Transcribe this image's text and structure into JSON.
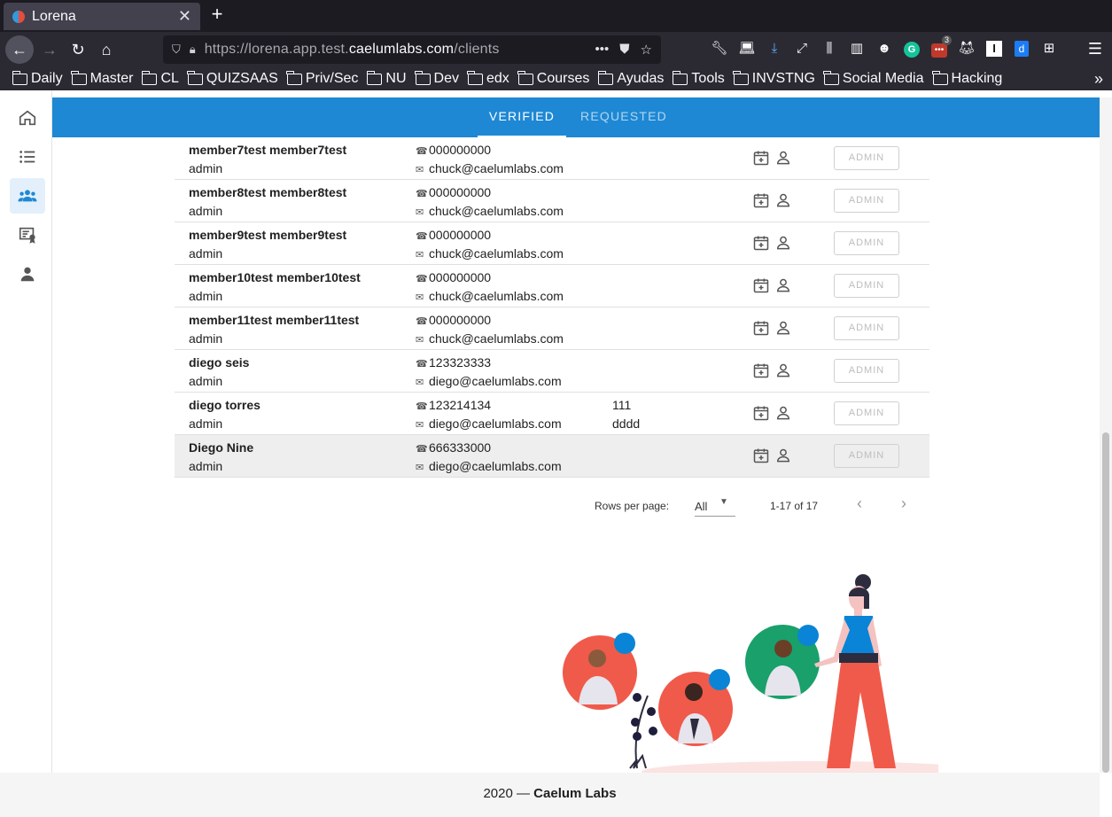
{
  "browser": {
    "tab_title": "Lorena",
    "tab_close": "✕",
    "new_tab": "+",
    "url_prefix": "https://lorena.app.test.",
    "url_domain": "caelumlabs.com",
    "url_path": "/clients",
    "toolbar_badge": "3",
    "bookmarks": [
      "Daily",
      "Master",
      "CL",
      "QUIZSAAS",
      "Priv/Sec",
      "NU",
      "Dev",
      "edx",
      "Courses",
      "Ayudas",
      "Tools",
      "INVSTNG",
      "Social Media",
      "Hacking"
    ]
  },
  "header": {
    "tab_verified": "VERIFIED",
    "tab_requested": "REQUESTED"
  },
  "nav": {
    "items": [
      "home-icon",
      "list-icon",
      "group-icon",
      "certificate-icon",
      "person-icon"
    ],
    "active": "group-icon"
  },
  "clients": [
    {
      "name": "member7test member7test",
      "role": "admin",
      "phone": "000000000",
      "email": "chuck@caelumlabs.com",
      "extra1": "",
      "extra2": "",
      "action": "ADMIN"
    },
    {
      "name": "member8test member8test",
      "role": "admin",
      "phone": "000000000",
      "email": "chuck@caelumlabs.com",
      "extra1": "",
      "extra2": "",
      "action": "ADMIN"
    },
    {
      "name": "member9test member9test",
      "role": "admin",
      "phone": "000000000",
      "email": "chuck@caelumlabs.com",
      "extra1": "",
      "extra2": "",
      "action": "ADMIN"
    },
    {
      "name": "member10test member10test",
      "role": "admin",
      "phone": "000000000",
      "email": "chuck@caelumlabs.com",
      "extra1": "",
      "extra2": "",
      "action": "ADMIN"
    },
    {
      "name": "member11test member11test",
      "role": "admin",
      "phone": "000000000",
      "email": "chuck@caelumlabs.com",
      "extra1": "",
      "extra2": "",
      "action": "ADMIN"
    },
    {
      "name": "diego seis",
      "role": "admin",
      "phone": "123323333",
      "email": "diego@caelumlabs.com",
      "extra1": "",
      "extra2": "",
      "action": "ADMIN"
    },
    {
      "name": "diego torres",
      "role": "admin",
      "phone": "123214134",
      "email": "diego@caelumlabs.com",
      "extra1": "111",
      "extra2": "dddd",
      "action": "ADMIN"
    },
    {
      "name": "Diego Nine",
      "role": "admin",
      "phone": "666333000",
      "email": "diego@caelumlabs.com",
      "extra1": "",
      "extra2": "",
      "action": "ADMIN"
    }
  ],
  "pagination": {
    "rows_per_page_label": "Rows per page:",
    "rows_per_page_value": "All",
    "range": "1-17 of 17"
  },
  "footer": {
    "year": "2020 —",
    "company": "Caelum Labs"
  },
  "colors": {
    "header": "#1e88d4",
    "accent_circle": "#f05a4a",
    "dot_blue": "#0a84d6",
    "green_circle": "#1aa06a"
  }
}
